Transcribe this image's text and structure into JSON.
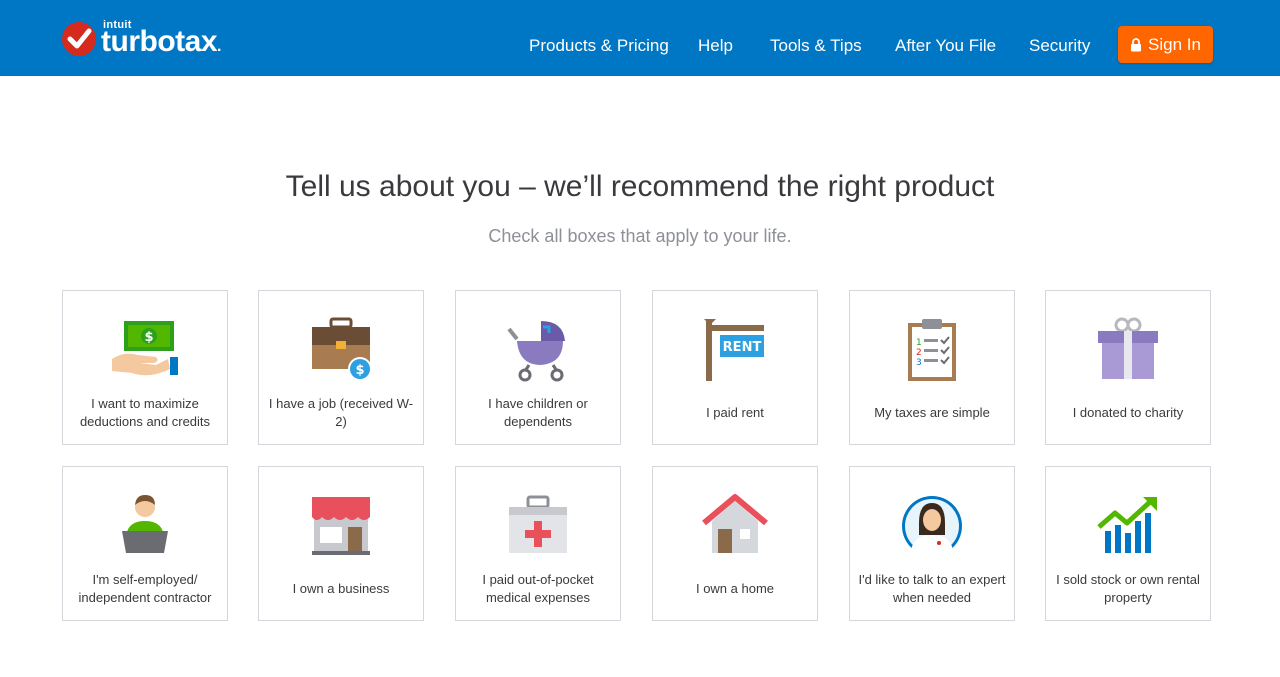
{
  "header": {
    "logo_top": "intuit",
    "logo_word": "turbotax",
    "nav": [
      {
        "label": "Products & Pricing"
      },
      {
        "label": "Help"
      },
      {
        "label": "Tools & Tips"
      },
      {
        "label": "After You File"
      },
      {
        "label": "Security"
      }
    ],
    "sign_in": "Sign In"
  },
  "main": {
    "headline": "Tell us about you – we’ll recommend the right product",
    "subline": "Check all boxes that apply to your life."
  },
  "cards": [
    {
      "label": "I want to maximize deductions and credits",
      "icon": "money-hand-icon"
    },
    {
      "label": "I have a job (received W-2)",
      "icon": "briefcase-icon"
    },
    {
      "label": "I have children or dependents",
      "icon": "stroller-icon"
    },
    {
      "label": "I paid rent",
      "icon": "rent-sign-icon",
      "sign_text": "RENT"
    },
    {
      "label": "My taxes are simple",
      "icon": "clipboard-icon"
    },
    {
      "label": "I donated to charity",
      "icon": "gift-icon"
    },
    {
      "label": "I'm self-employed/ independent contractor",
      "icon": "laptop-person-icon"
    },
    {
      "label": "I own a business",
      "icon": "storefront-icon"
    },
    {
      "label": "I paid out-of-pocket medical expenses",
      "icon": "medical-kit-icon"
    },
    {
      "label": "I own a home",
      "icon": "house-icon"
    },
    {
      "label": "I'd like to talk to an expert when needed",
      "icon": "expert-avatar-icon"
    },
    {
      "label": "I sold stock or own rental property",
      "icon": "stock-chart-icon"
    }
  ],
  "colors": {
    "brand_blue": "#0077c5",
    "sign_in_orange": "#ff6600",
    "check_red": "#d52b1e"
  }
}
